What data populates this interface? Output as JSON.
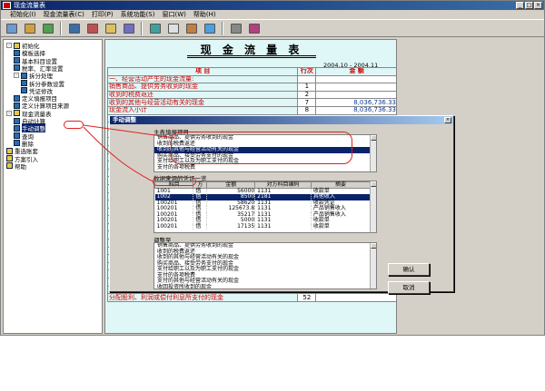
{
  "window": {
    "title": "现金流量表"
  },
  "menu": [
    "初始化(I)",
    "现金流量表(C)",
    "打印(P)",
    "系统功能(S)",
    "窗口(W)",
    "帮助(H)"
  ],
  "tree": [
    {
      "label": "初始化",
      "level": 0,
      "expander": "-",
      "icon": "folder-icon"
    },
    {
      "label": "模板选择",
      "level": 1,
      "icon": "doc-icon"
    },
    {
      "label": "基本科目设置",
      "level": 1,
      "icon": "doc-icon"
    },
    {
      "label": "税率、汇率设置",
      "level": 1,
      "icon": "doc-icon"
    },
    {
      "label": "拆分处理",
      "level": 1,
      "expander": "-",
      "icon": "folder-icon"
    },
    {
      "label": "拆分参数设置",
      "level": 2,
      "icon": "doc-icon"
    },
    {
      "label": "凭证修改",
      "level": 2,
      "icon": "doc-icon"
    },
    {
      "label": "定义填报项目",
      "level": 1,
      "icon": "doc-icon"
    },
    {
      "label": "定义计算项目来源",
      "level": 1,
      "icon": "doc-icon"
    },
    {
      "label": "现金流量表",
      "level": 0,
      "expander": "-",
      "icon": "folder-icon"
    },
    {
      "label": "自动计算",
      "level": 1,
      "icon": "doc-icon"
    },
    {
      "label": "手动调整",
      "level": 1,
      "icon": "doc-icon",
      "selected": true
    },
    {
      "label": "查询",
      "level": 1,
      "icon": "doc-icon"
    },
    {
      "label": "删除",
      "level": 1,
      "icon": "doc-icon"
    },
    {
      "label": "重选账套",
      "level": 0,
      "icon": "doc-icon"
    },
    {
      "label": "方案引入",
      "level": 0,
      "icon": "doc-icon"
    },
    {
      "label": "帮助",
      "level": 0,
      "icon": "doc-icon"
    }
  ],
  "report": {
    "title": "现 金 流 量 表",
    "date_range": "2004.10 - 2004.11",
    "headers": [
      "项        目",
      "行次",
      "金        额"
    ],
    "rows": [
      {
        "item": "一、经营活动产生的现金流量:",
        "no": "",
        "amount": ""
      },
      {
        "item": "销售商品、提供劳务收到的现金",
        "no": "1",
        "amount": ""
      },
      {
        "item": "收到的税费返还",
        "no": "2",
        "amount": ""
      },
      {
        "item": "收到的其他与经营活动有关的现金",
        "no": "7",
        "amount": "8,036,736.33"
      },
      {
        "item": "现金流入小计",
        "no": "8",
        "amount": "8,036,736.33"
      },
      {
        "item": "购买商品",
        "no": "",
        "amount": ""
      },
      {
        "item": "支付给职",
        "no": "",
        "amount": ""
      },
      {
        "item": "支付的各",
        "no": "",
        "amount": ""
      },
      {
        "item": "支付的其",
        "no": "",
        "amount": ""
      },
      {
        "item": "现金流",
        "no": "",
        "amount": ""
      },
      {
        "item": "经营活动产生的",
        "no": "",
        "amount": ""
      },
      {
        "item": "二、投资活动",
        "no": "",
        "amount": ""
      },
      {
        "item": "收回投资",
        "no": "",
        "amount": ""
      },
      {
        "item": "取得投资",
        "no": "",
        "amount": ""
      },
      {
        "item": "处置固定",
        "no": "",
        "amount": ""
      },
      {
        "item": "收到的其",
        "no": "",
        "amount": ""
      },
      {
        "item": "现金流",
        "no": "",
        "amount": ""
      },
      {
        "item": "购建固定",
        "no": "",
        "amount": ""
      },
      {
        "item": "投资所支",
        "no": "",
        "amount": ""
      },
      {
        "item": "支付的其",
        "no": "",
        "amount": ""
      },
      {
        "item": "现金流",
        "no": "",
        "amount": ""
      },
      {
        "item": "投资活动产生的",
        "no": "",
        "amount": ""
      },
      {
        "item": "三、筹资活动",
        "no": "",
        "amount": ""
      },
      {
        "item": "吸收投资",
        "no": "",
        "amount": ""
      },
      {
        "item": "借款所收",
        "no": "",
        "amount": ""
      },
      {
        "item": "收到的其他与筹资活动有关的现金",
        "no": "49",
        "amount": ""
      },
      {
        "item": "现金流入小计",
        "no": "50",
        "amount": ""
      },
      {
        "item": "偿还债务所支付的现金",
        "no": "51",
        "amount": ""
      },
      {
        "item": "分配股利、利润或偿付利息所支付的现金",
        "no": "52",
        "amount": ""
      }
    ]
  },
  "dialog": {
    "title": "手动调整",
    "main_group_label": "主表填报项目",
    "main_items": [
      "销售商品、提供劳务收到的现金",
      "收到的税费返还",
      "收到的其他与经营活动有关的现金",
      "购买商品、接受劳务支付的现金",
      "支付给职工以及为职工支付的现金",
      "支付的各项税费"
    ],
    "main_selected": 2,
    "source_label": "数据来源的凭证一览",
    "grid_headers": [
      "科目",
      "方",
      "金额",
      "对方科目编码",
      "摘要"
    ],
    "grid_rows": [
      [
        "1001",
        "借",
        "56000",
        "1131",
        "收款单"
      ],
      [
        "1002",
        "借",
        "8500",
        "2181",
        "其他收入"
      ],
      [
        "100201",
        "借",
        "58620",
        "1131",
        "收款凭证"
      ],
      [
        "100201",
        "借",
        "125673.8",
        "1131",
        "产品销售收入"
      ],
      [
        "100201",
        "借",
        "35217",
        "1131",
        "产品销售收入"
      ],
      [
        "100201",
        "借",
        "5000",
        "1131",
        "收款单"
      ],
      [
        "100201",
        "借",
        "17135",
        "1131",
        "收款单"
      ]
    ],
    "grid_selected": 1,
    "adjust_label": "调整至",
    "adjust_items": [
      "销售商品、提供劳务收到的现金",
      "收到的税费返还",
      "收到的其他与经营活动有关的现金",
      "购买商品、接受劳务支付的现金",
      "支付给职工以及为职工支付的现金",
      "支付的各项税费",
      "支付的其他与经营活动有关的现金",
      "收回投资所收到的现金",
      "取得投资收益所收到的现金",
      "处置固定资产、无形资产和其他长期资产",
      "收到的其他与投资活动有关的现金"
    ],
    "ok_label": "确认",
    "cancel_label": "取消"
  }
}
